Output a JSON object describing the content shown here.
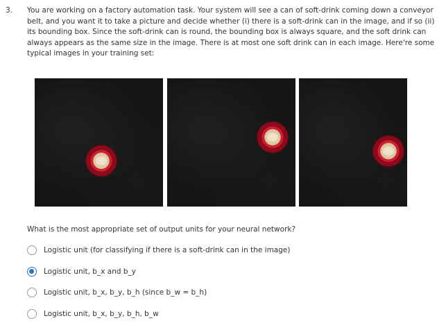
{
  "question": {
    "number": "3.",
    "text": "You are working on a factory automation task. Your system will see a can of soft-drink coming down a conveyor belt, and you want it to take a picture and decide whether (i) there is a soft-drink can in the image, and if so (ii) its bounding box. Since the soft-drink can is round, the bounding box is always square, and the soft drink can always appears as the same size in the image. There is at most one soft drink can in each image. Here're some typical images in your training set:",
    "prompt": "What is the most appropriate set of output units for your neural network?"
  },
  "options": [
    {
      "label": "Logistic unit (for classifying if there is a soft-drink can in the image)",
      "selected": false
    },
    {
      "label": "Logistic unit, b_x and b_y",
      "selected": true
    },
    {
      "label": "Logistic unit, b_x, b_y, b_h (since b_w = b_h)",
      "selected": false
    },
    {
      "label": "Logistic unit, b_x, b_y, b_h, b_w",
      "selected": false
    }
  ],
  "colors": {
    "accent": "#2a73c4",
    "text": "#333333",
    "image_background": "#141414",
    "can_red": "#c8102e"
  }
}
